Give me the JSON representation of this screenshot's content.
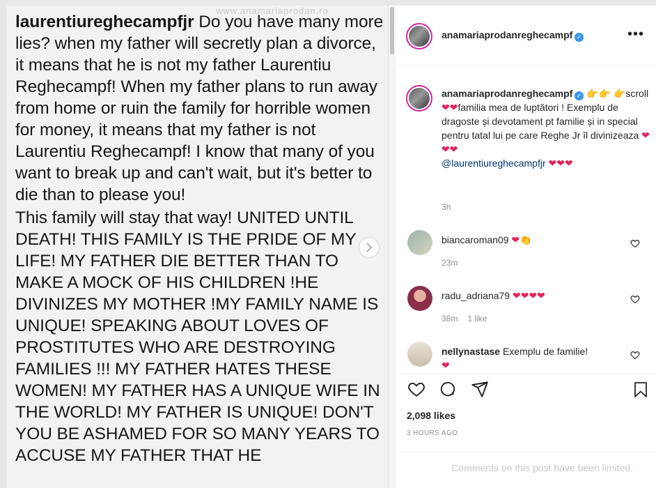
{
  "post_image": {
    "watermark": "www.anamariaprodan.ro",
    "handle": "laurentiureghecampfjr",
    "para1_rest": " Do you have many more lies? when my father will secretly plan a divorce, it means that he is not my father Laurentiu Reghecampf! When my father plans to run away from home or ruin the family for horrible women for money, it means that my father is not Laurentiu Reghecampf! I know that many of you want to break up and can't wait, but it's better to die than to please you!",
    "para2": " This family will stay that way! UNITED UNTIL DEATH! THIS FAMILY IS THE PRIDE OF MY LIFE! MY FATHER DIE BETTER THAN TO MAKE A MOCK OF HIS CHILDREN !HE DIVINIZES MY MOTHER !MY FAMILY NAME IS UNIQUE! SPEAKING ABOUT LOVES OF PROSTITUTES WHO ARE DESTROYING FAMILIES !!! MY FATHER HATES THESE WOMEN! MY  FATHER HAS A UNIQUE WIFE IN THE WORLD! MY FATHER IS UNIQUE! DON'T YOU BE ASHAMED FOR SO MANY YEARS TO ACCUSE MY FATHER THAT HE"
  },
  "header": {
    "username": "anamariaprodanreghecampf",
    "more": "•••"
  },
  "caption": {
    "username": "anamariaprodanreghecampf",
    "hands1": "👉👉",
    "hand2": "👉",
    "part1": "scroll ",
    "hearts_a": "❤❤",
    "part2": "familia mea de luptători ! Exemplu de dragoste și devotament pt familie și in special pentru tatal lui pe care Reghe Jr îl divinizeaza ",
    "hearts_b": "❤❤❤",
    "mention": "@laurentiureghecampfjr",
    "hearts_c": "❤❤❤",
    "time": "3h"
  },
  "comments": [
    {
      "username": "biancaroman09",
      "text": "❤👏",
      "time": "23m",
      "likes": ""
    },
    {
      "username": "radu_adriana79",
      "text": "❤❤❤❤",
      "time": "38m",
      "likes": "1 like"
    },
    {
      "username": "nellynastase",
      "text": "Exemplu de familie!",
      "emoji": "❤",
      "time": "",
      "likes": ""
    }
  ],
  "likes": "2,098 likes",
  "ago": "3 HOURS AGO",
  "limited": "Comments on this post have been limited.",
  "colors": {
    "heart": "#e0245e",
    "verified": "#3897f0",
    "link": "#00376b"
  }
}
